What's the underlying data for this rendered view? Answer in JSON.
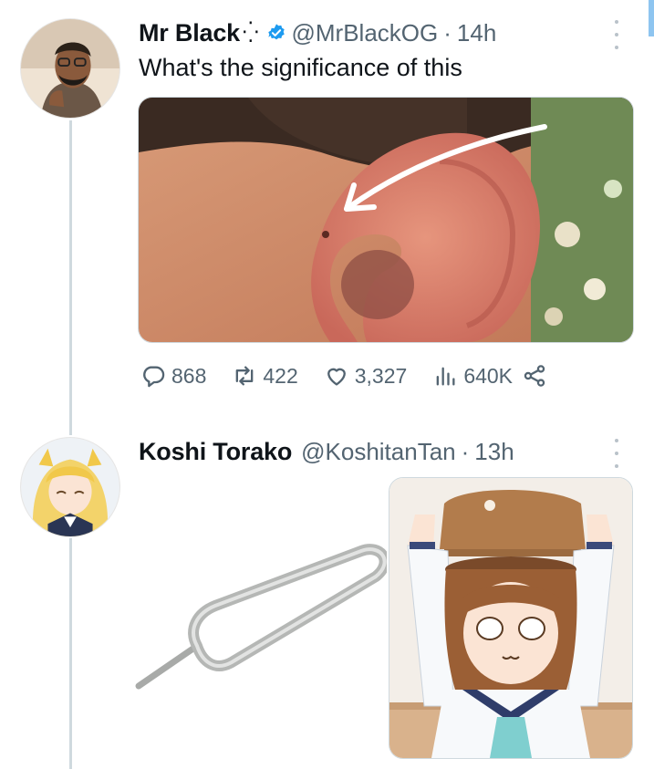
{
  "tweets": [
    {
      "display_name": "Mr Black",
      "name_suffix": "⁛",
      "verified": true,
      "handle": "@MrBlackOG",
      "separator": "·",
      "time": "14h",
      "text": "What's the significance of this",
      "media": "ear-photo-with-arrow",
      "actions": {
        "replies": "868",
        "reposts": "422",
        "likes": "3,327",
        "views": "640K"
      }
    },
    {
      "display_name": "Koshi Torako",
      "handle": "@KoshitanTan",
      "separator": "·",
      "time": "13h",
      "media": "sim-ejector-pin-and-anime-meme"
    }
  ],
  "icons": {
    "reply": "reply-icon",
    "repost": "repost-icon",
    "like": "heart-icon",
    "views": "views-bar-icon",
    "share": "share-icon",
    "more": "more-vertical-icon",
    "verified": "verified-badge-icon"
  },
  "colors": {
    "text": "#0f1419",
    "muted": "#536471",
    "verified_blue": "#1d9bf0",
    "thread_line": "#cfd9de"
  }
}
